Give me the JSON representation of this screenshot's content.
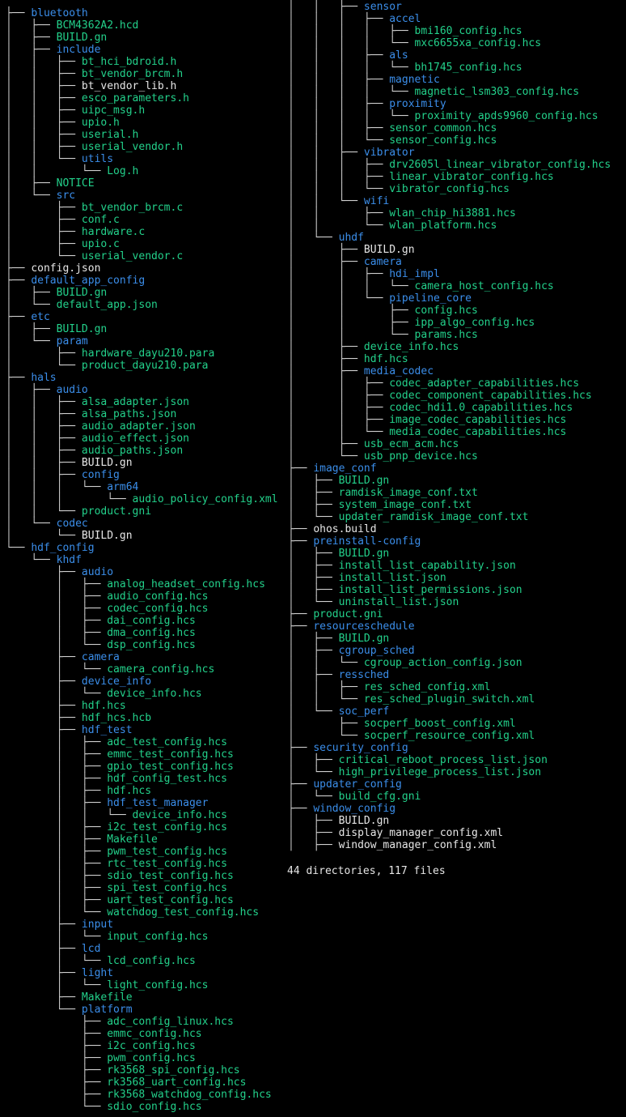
{
  "tree": {
    "left": [
      [
        0,
        "bluetooth",
        "dir"
      ],
      [
        1,
        "BCM4362A2.hcd",
        "src"
      ],
      [
        1,
        "BUILD.gn",
        "src"
      ],
      [
        1,
        "include",
        "dir"
      ],
      [
        2,
        "bt_hci_bdroid.h",
        "src"
      ],
      [
        2,
        "bt_vendor_brcm.h",
        "src"
      ],
      [
        2,
        "bt_vendor_lib.h",
        "plain"
      ],
      [
        2,
        "esco_parameters.h",
        "src"
      ],
      [
        2,
        "uipc_msg.h",
        "src"
      ],
      [
        2,
        "upio.h",
        "src"
      ],
      [
        2,
        "userial.h",
        "src"
      ],
      [
        2,
        "userial_vendor.h",
        "src"
      ],
      [
        2,
        "utils",
        "dir"
      ],
      [
        3,
        "Log.h",
        "src"
      ],
      [
        1,
        "NOTICE",
        "src"
      ],
      [
        1,
        "src",
        "dir"
      ],
      [
        2,
        "bt_vendor_brcm.c",
        "src"
      ],
      [
        2,
        "conf.c",
        "src"
      ],
      [
        2,
        "hardware.c",
        "src"
      ],
      [
        2,
        "upio.c",
        "src"
      ],
      [
        2,
        "userial_vendor.c",
        "src"
      ],
      [
        0,
        "config.json",
        "plain"
      ],
      [
        0,
        "default_app_config",
        "dir"
      ],
      [
        1,
        "BUILD.gn",
        "src"
      ],
      [
        1,
        "default_app.json",
        "src"
      ],
      [
        0,
        "etc",
        "dir"
      ],
      [
        1,
        "BUILD.gn",
        "src"
      ],
      [
        1,
        "param",
        "dir"
      ],
      [
        2,
        "hardware_dayu210.para",
        "src"
      ],
      [
        2,
        "product_dayu210.para",
        "src"
      ],
      [
        0,
        "hals",
        "dir"
      ],
      [
        1,
        "audio",
        "dir"
      ],
      [
        2,
        "alsa_adapter.json",
        "src"
      ],
      [
        2,
        "alsa_paths.json",
        "src"
      ],
      [
        2,
        "audio_adapter.json",
        "src"
      ],
      [
        2,
        "audio_effect.json",
        "src"
      ],
      [
        2,
        "audio_paths.json",
        "src"
      ],
      [
        2,
        "BUILD.gn",
        "plain"
      ],
      [
        2,
        "config",
        "dir"
      ],
      [
        3,
        "arm64",
        "dir"
      ],
      [
        4,
        "audio_policy_config.xml",
        "src"
      ],
      [
        2,
        "product.gni",
        "src"
      ],
      [
        1,
        "codec",
        "dir"
      ],
      [
        2,
        "BUILD.gn",
        "plain"
      ],
      [
        0,
        "hdf_config",
        "dir"
      ],
      [
        1,
        "khdf",
        "dir"
      ],
      [
        2,
        "audio",
        "dir"
      ],
      [
        3,
        "analog_headset_config.hcs",
        "src"
      ],
      [
        3,
        "audio_config.hcs",
        "src"
      ],
      [
        3,
        "codec_config.hcs",
        "src"
      ],
      [
        3,
        "dai_config.hcs",
        "src"
      ],
      [
        3,
        "dma_config.hcs",
        "src"
      ],
      [
        3,
        "dsp_config.hcs",
        "src"
      ],
      [
        2,
        "camera",
        "dir"
      ],
      [
        3,
        "camera_config.hcs",
        "src"
      ],
      [
        2,
        "device_info",
        "dir"
      ],
      [
        3,
        "device_info.hcs",
        "src"
      ],
      [
        2,
        "hdf.hcs",
        "src"
      ],
      [
        2,
        "hdf_hcs.hcb",
        "src"
      ],
      [
        2,
        "hdf_test",
        "dir"
      ],
      [
        3,
        "adc_test_config.hcs",
        "src"
      ],
      [
        3,
        "emmc_test_config.hcs",
        "src"
      ],
      [
        3,
        "gpio_test_config.hcs",
        "src"
      ],
      [
        3,
        "hdf_config_test.hcs",
        "src"
      ],
      [
        3,
        "hdf.hcs",
        "src"
      ],
      [
        3,
        "hdf_test_manager",
        "dir"
      ],
      [
        4,
        "device_info.hcs",
        "src"
      ],
      [
        3,
        "i2c_test_config.hcs",
        "src"
      ],
      [
        3,
        "Makefile",
        "src"
      ],
      [
        3,
        "pwm_test_config.hcs",
        "src"
      ],
      [
        3,
        "rtc_test_config.hcs",
        "src"
      ],
      [
        3,
        "sdio_test_config.hcs",
        "src"
      ],
      [
        3,
        "spi_test_config.hcs",
        "src"
      ],
      [
        3,
        "uart_test_config.hcs",
        "src"
      ],
      [
        3,
        "watchdog_test_config.hcs",
        "src"
      ],
      [
        2,
        "input",
        "dir"
      ],
      [
        3,
        "input_config.hcs",
        "src"
      ],
      [
        2,
        "lcd",
        "dir"
      ],
      [
        3,
        "lcd_config.hcs",
        "src"
      ],
      [
        2,
        "light",
        "dir"
      ],
      [
        3,
        "light_config.hcs",
        "src"
      ],
      [
        2,
        "Makefile",
        "src"
      ],
      [
        2,
        "platform",
        "dir"
      ],
      [
        3,
        "adc_config_linux.hcs",
        "src"
      ],
      [
        3,
        "emmc_config.hcs",
        "src"
      ],
      [
        3,
        "i2c_config.hcs",
        "src"
      ],
      [
        3,
        "pwm_config.hcs",
        "src"
      ],
      [
        3,
        "rk3568_spi_config.hcs",
        "src"
      ],
      [
        3,
        "rk3568_uart_config.hcs",
        "src"
      ],
      [
        3,
        "rk3568_watchdog_config.hcs",
        "src"
      ],
      [
        3,
        "sdio_config.hcs",
        "src"
      ]
    ],
    "right": [
      [
        2,
        "sensor",
        "dir"
      ],
      [
        3,
        "accel",
        "dir"
      ],
      [
        4,
        "bmi160_config.hcs",
        "src"
      ],
      [
        4,
        "mxc6655xa_config.hcs",
        "src"
      ],
      [
        3,
        "als",
        "dir"
      ],
      [
        4,
        "bh1745_config.hcs",
        "src"
      ],
      [
        3,
        "magnetic",
        "dir"
      ],
      [
        4,
        "magnetic_lsm303_config.hcs",
        "src"
      ],
      [
        3,
        "proximity",
        "dir"
      ],
      [
        4,
        "proximity_apds9960_config.hcs",
        "src"
      ],
      [
        3,
        "sensor_common.hcs",
        "src"
      ],
      [
        3,
        "sensor_config.hcs",
        "src"
      ],
      [
        2,
        "vibrator",
        "dir"
      ],
      [
        3,
        "drv2605l_linear_vibrator_config.hcs",
        "src"
      ],
      [
        3,
        "linear_vibrator_config.hcs",
        "src"
      ],
      [
        3,
        "vibrator_config.hcs",
        "src"
      ],
      [
        2,
        "wifi",
        "dir"
      ],
      [
        3,
        "wlan_chip_hi3881.hcs",
        "src"
      ],
      [
        3,
        "wlan_platform.hcs",
        "src"
      ],
      [
        1,
        "uhdf",
        "dir"
      ],
      [
        2,
        "BUILD.gn",
        "plain"
      ],
      [
        2,
        "camera",
        "dir"
      ],
      [
        3,
        "hdi_impl",
        "dir"
      ],
      [
        4,
        "camera_host_config.hcs",
        "src"
      ],
      [
        3,
        "pipeline_core",
        "dir"
      ],
      [
        4,
        "config.hcs",
        "src"
      ],
      [
        4,
        "ipp_algo_config.hcs",
        "src"
      ],
      [
        4,
        "params.hcs",
        "src"
      ],
      [
        2,
        "device_info.hcs",
        "src"
      ],
      [
        2,
        "hdf.hcs",
        "src"
      ],
      [
        2,
        "media_codec",
        "dir"
      ],
      [
        3,
        "codec_adapter_capabilities.hcs",
        "src"
      ],
      [
        3,
        "codec_component_capabilities.hcs",
        "src"
      ],
      [
        3,
        "codec_hdi1.0_capabilities.hcs",
        "src"
      ],
      [
        3,
        "image_codec_capabilities.hcs",
        "src"
      ],
      [
        3,
        "media_codec_capabilities.hcs",
        "src"
      ],
      [
        2,
        "usb_ecm_acm.hcs",
        "src"
      ],
      [
        2,
        "usb_pnp_device.hcs",
        "src"
      ],
      [
        0,
        "image_conf",
        "dir"
      ],
      [
        1,
        "BUILD.gn",
        "src"
      ],
      [
        1,
        "ramdisk_image_conf.txt",
        "src"
      ],
      [
        1,
        "system_image_conf.txt",
        "src"
      ],
      [
        1,
        "updater_ramdisk_image_conf.txt",
        "src"
      ],
      [
        0,
        "ohos.build",
        "plain"
      ],
      [
        0,
        "preinstall-config",
        "dir"
      ],
      [
        1,
        "BUILD.gn",
        "src"
      ],
      [
        1,
        "install_list_capability.json",
        "src"
      ],
      [
        1,
        "install_list.json",
        "src"
      ],
      [
        1,
        "install_list_permissions.json",
        "src"
      ],
      [
        1,
        "uninstall_list.json",
        "src"
      ],
      [
        0,
        "product.gni",
        "src"
      ],
      [
        0,
        "resourceschedule",
        "dir"
      ],
      [
        1,
        "BUILD.gn",
        "src"
      ],
      [
        1,
        "cgroup_sched",
        "dir"
      ],
      [
        2,
        "cgroup_action_config.json",
        "src"
      ],
      [
        1,
        "ressched",
        "dir"
      ],
      [
        2,
        "res_sched_config.xml",
        "src"
      ],
      [
        2,
        "res_sched_plugin_switch.xml",
        "src"
      ],
      [
        1,
        "soc_perf",
        "dir"
      ],
      [
        2,
        "socperf_boost_config.xml",
        "src"
      ],
      [
        2,
        "socperf_resource_config.xml",
        "src"
      ],
      [
        0,
        "security_config",
        "dir"
      ],
      [
        1,
        "critical_reboot_process_list.json",
        "src"
      ],
      [
        1,
        "high_privilege_process_list.json",
        "src"
      ],
      [
        0,
        "updater_config",
        "dir"
      ],
      [
        1,
        "build_cfg.gni",
        "src"
      ],
      [
        0,
        "window_config",
        "dir"
      ],
      [
        1,
        "BUILD.gn",
        "plain"
      ],
      [
        1,
        "display_manager_config.xml",
        "plain"
      ],
      [
        1,
        "window_manager_config.xml",
        "plain"
      ]
    ]
  },
  "summary": "44 directories, 117 files",
  "colors": {
    "directory": "#3b8eea",
    "source_file": "#23d18b",
    "plain_file": "#e6e6e6",
    "background": "#000000"
  }
}
